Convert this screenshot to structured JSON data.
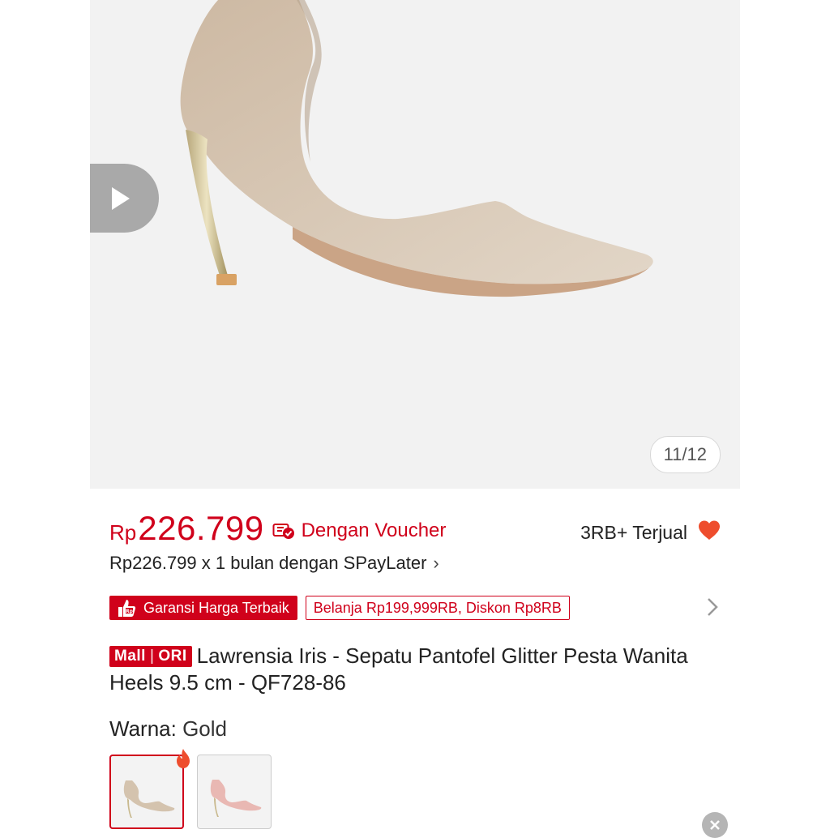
{
  "gallery": {
    "counter": "11/12"
  },
  "price": {
    "currency": "Rp",
    "amount": "226.799",
    "voucher_text": "Dengan Voucher"
  },
  "sold": {
    "text": "3RB+ Terjual"
  },
  "paylater": {
    "text": "Rp226.799 x 1 bulan dengan SPayLater",
    "chevron": "›"
  },
  "badges": {
    "guarantee": "Garansi Harga Terbaik",
    "discount": "Belanja Rp199,999RB, Diskon Rp8RB"
  },
  "product": {
    "mall_label": "Mall",
    "ori_label": "ORI",
    "title": "Lawrensia Iris - Sepatu Pantofel Glitter Pesta Wanita Heels 9.5 cm - QF728-86"
  },
  "variant": {
    "label": "Warna:",
    "value": "Gold",
    "options": [
      "gold",
      "pink"
    ]
  },
  "colors": {
    "accent": "#d0011b",
    "heart": "#ee4d2d"
  },
  "icons": [
    "play-icon",
    "voucher-icon",
    "heart-icon",
    "chevron-right-icon",
    "price-guarantee-icon",
    "fire-icon",
    "close-icon"
  ]
}
